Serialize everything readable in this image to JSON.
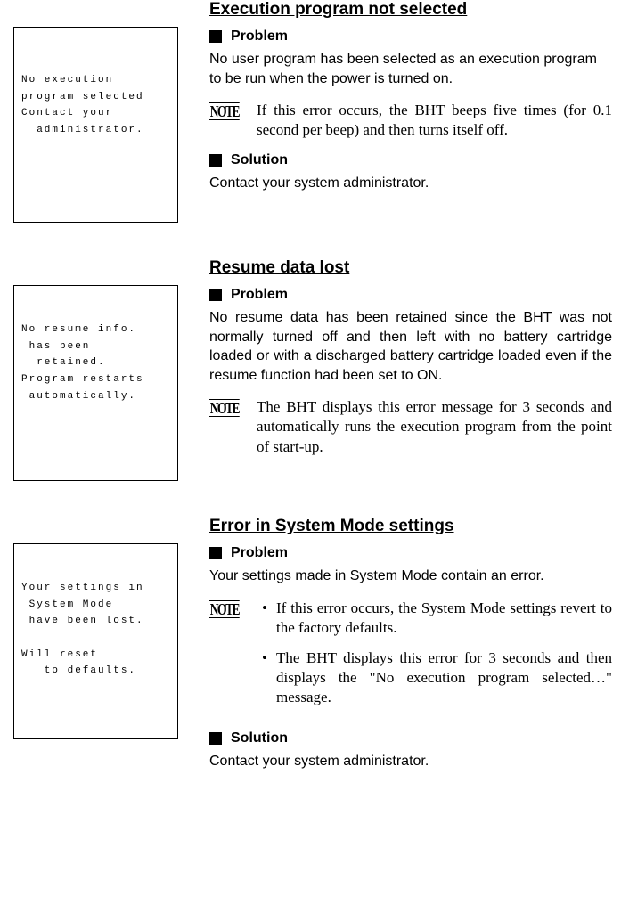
{
  "sections": [
    {
      "title": "Execution program not selected",
      "screen": "No execution\nprogram selected\nContact your\n  administrator.",
      "problem_label": "Problem",
      "problem_text": "No user program has been selected as an execution program to be run when the power is turned on.",
      "note_label": "NOTE",
      "note_text": "If this error occurs, the BHT beeps five times (for 0.1 second per beep) and then turns itself off.",
      "solution_label": "Solution",
      "solution_text": "Contact your system administrator."
    },
    {
      "title": "Resume data lost",
      "screen": "No resume info.\n has been\n  retained.\nProgram restarts\n automatically.",
      "problem_label": "Problem",
      "problem_text": "No resume data has been retained since the BHT was not normally turned off and then left with no battery cartridge loaded or with a discharged battery cartridge loaded even if the resume function had been set to ON.",
      "note_label": "NOTE",
      "note_text": "The BHT displays this error message for 3 seconds and automatically runs the execution program from the point of start-up."
    },
    {
      "title": "Error in System Mode settings",
      "screen": "Your settings in\n System Mode\n have been lost.\n\nWill reset\n   to defaults.",
      "problem_label": "Problem",
      "problem_text": "Your settings made in System Mode contain an error.",
      "note_label": "NOTE",
      "note_bullets": [
        "If this error occurs, the System Mode settings revert to the factory defaults.",
        "The BHT displays this error for 3 seconds and then displays the \"No execution program selected…\" message."
      ],
      "solution_label": "Solution",
      "solution_text": "Contact your system administrator."
    }
  ]
}
